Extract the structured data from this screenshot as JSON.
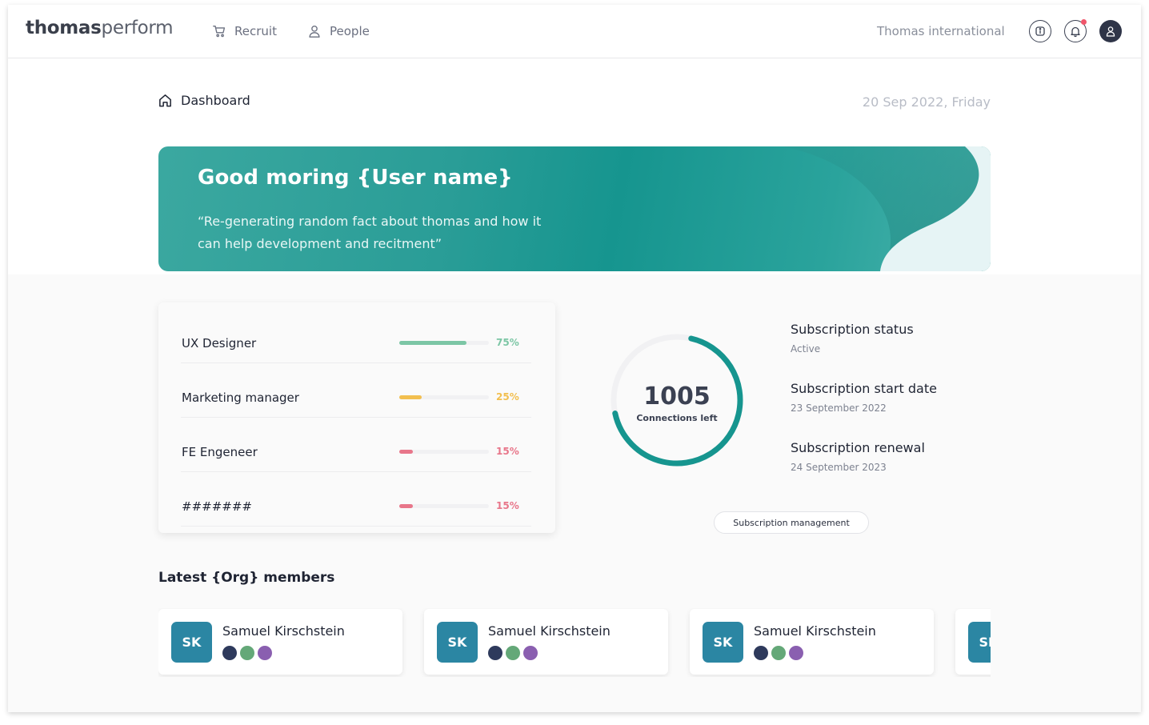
{
  "app": {
    "logo_bold": "thomas",
    "logo_light": "perform",
    "nav": [
      {
        "label": "Recruit",
        "icon": "cart-icon"
      },
      {
        "label": "People",
        "icon": "person-icon"
      }
    ],
    "org_name": "Thomas international",
    "icons": [
      "info-icon",
      "bell-icon",
      "user-avatar-icon"
    ],
    "notification_color": "#f0566b"
  },
  "breadcrumb": {
    "icon": "home-icon",
    "label": "Dashboard"
  },
  "date": "20 Sep 2022, Friday",
  "banner": {
    "title": "Good moring {User name}",
    "quote": "“Re-generating random fact about thomas and how it can help development and recitment”",
    "accent": "#16958f"
  },
  "jobs": [
    {
      "name": "UX Designer",
      "percent": 75,
      "percent_label": "75%",
      "color": "#7cc6a5"
    },
    {
      "name": "Marketing manager",
      "percent": 25,
      "percent_label": "25%",
      "color": "#f2bf4f"
    },
    {
      "name": "FE Engeneer",
      "percent": 15,
      "percent_label": "15%",
      "color": "#e8768a"
    },
    {
      "name": "#######",
      "percent": 15,
      "percent_label": "15%",
      "color": "#e8768a"
    }
  ],
  "connections": {
    "value": "1005",
    "label": "Connections left",
    "ring_fraction": 0.68,
    "ring_color": "#16958f"
  },
  "subscription": {
    "status_title": "Subscription status",
    "status_value": "Active",
    "start_title": "Subscription start date",
    "start_value": "23 September 2022",
    "renewal_title": "Subscription renewal",
    "renewal_value": "24 September 2023",
    "management_label": "Subscription management"
  },
  "members": {
    "title": "Latest {Org} members",
    "items": [
      {
        "initials": "SK",
        "name": "Samuel Kirschstein"
      },
      {
        "initials": "SK",
        "name": "Samuel Kirschstein"
      },
      {
        "initials": "SK",
        "name": "Samuel Kirschstein"
      },
      {
        "initials": "SK",
        "name": ""
      }
    ],
    "dot_colors": [
      "#2e3a5c",
      "#64a878",
      "#8a5fb0"
    ]
  }
}
